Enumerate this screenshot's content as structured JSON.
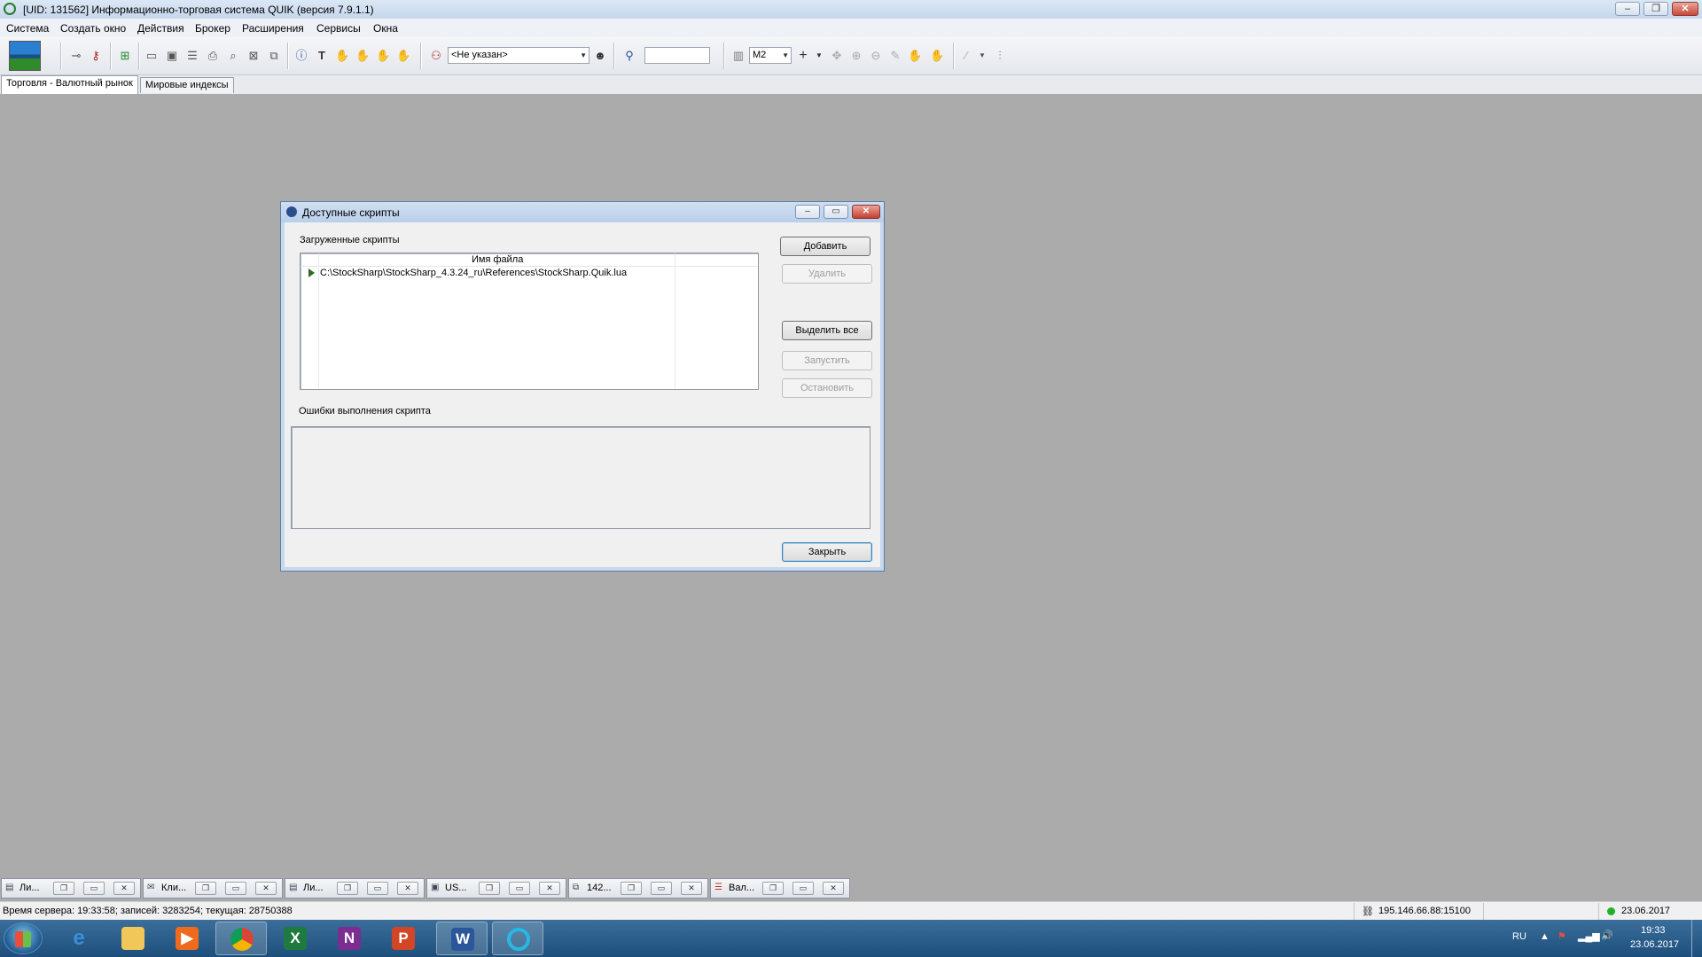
{
  "window": {
    "title": "[UID: 131562] Информационно-торговая система QUIK (версия 7.9.1.1)",
    "minimize": "–",
    "restore": "❐",
    "close": "✕"
  },
  "menu": [
    "Система",
    "Создать окно",
    "Действия",
    "Брокер",
    "Расширения",
    "Сервисы",
    "Окна"
  ],
  "toolbar": {
    "account_combo": "<Не указан>",
    "search_value": "",
    "interval_combo": "M2"
  },
  "tabs": [
    {
      "label": "Торговля - Валютный рынок",
      "active": true
    },
    {
      "label": "Мировые индексы",
      "active": false
    }
  ],
  "dialog": {
    "title": "Доступные скрипты",
    "loaded_label": "Загруженные скрипты",
    "column_filename": "Имя файла",
    "scripts": [
      "C:\\StockSharp\\StockSharp_4.3.24_ru\\References\\StockSharp.Quik.lua"
    ],
    "errors_label": "Ошибки выполнения скрипта",
    "errors_text": "",
    "buttons": {
      "add": "Добавить",
      "remove": "Удалить",
      "select_all": "Выделить все",
      "run": "Запустить",
      "stop": "Остановить",
      "close": "Закрыть"
    }
  },
  "windows_strip": [
    {
      "label": "Ли...",
      "icon": "document-icon"
    },
    {
      "label": "Кли...",
      "icon": "mail-icon"
    },
    {
      "label": "Ли...",
      "icon": "document-icon"
    },
    {
      "label": "US...",
      "icon": "chart-window-icon"
    },
    {
      "label": "142...",
      "icon": "orders-icon"
    },
    {
      "label": "Вал...",
      "icon": "table-icon"
    }
  ],
  "status": {
    "server_text": "Время сервера: 19:33:58; записей: 3283254; текущая: 28750388",
    "connection": "195.146.66.88:15100",
    "date": "23.06.2017",
    "connection_color": "#21b128"
  },
  "taskbar": {
    "apps": [
      "internet-explorer",
      "file-explorer",
      "media-player",
      "chrome",
      "excel",
      "onenote",
      "powerpoint",
      "word",
      "app-o"
    ],
    "lang": "RU",
    "time": "19:33",
    "date": "23.06.2017"
  }
}
